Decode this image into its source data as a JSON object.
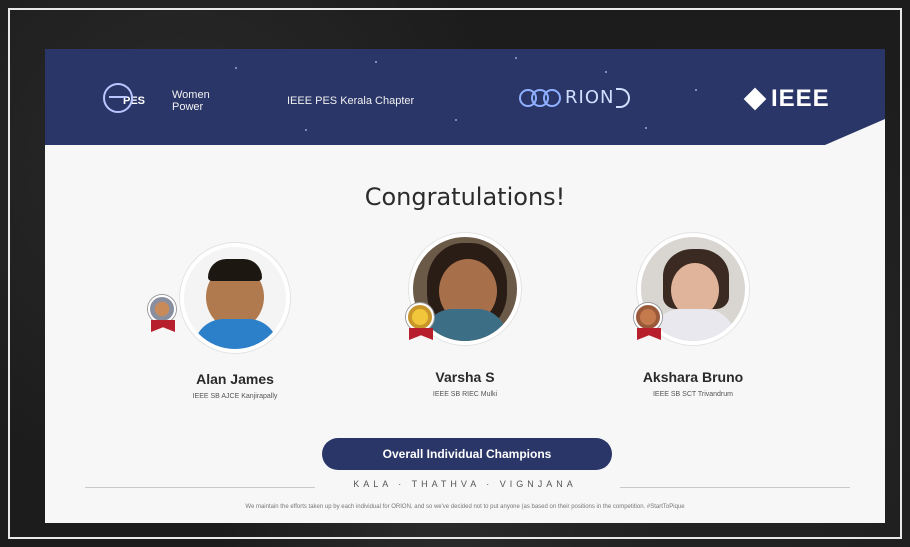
{
  "header": {
    "pes_logo_text": "PES",
    "wp_line1": "Women",
    "wp_line2": "Power",
    "chapter": "IEEE PES Kerala Chapter",
    "orion_word": "RION",
    "ieee_word": "IEEE",
    "colors": {
      "banner": "#2a3668",
      "accent": "#8fb0ff"
    }
  },
  "main": {
    "title": "Congratulations!",
    "winners": [
      {
        "name": "Alan James",
        "school": "IEEE SB AJCE Kanjirapally",
        "medal": "silver"
      },
      {
        "name": "Varsha S",
        "school": "IEEE SB RIEC Mulki",
        "medal": "gold"
      },
      {
        "name": "Akshara Bruno",
        "school": "IEEE SB SCT Trivandrum",
        "medal": "bronze"
      }
    ],
    "badge_label": "Overall Individual Champions",
    "tagline": "KALA · THATHVA · VIGNJANA",
    "footer": "We maintain the efforts taken up by each individual for ORION, and so we've decided not to put anyone (as based on their positions in the competition. #StartToPique"
  }
}
